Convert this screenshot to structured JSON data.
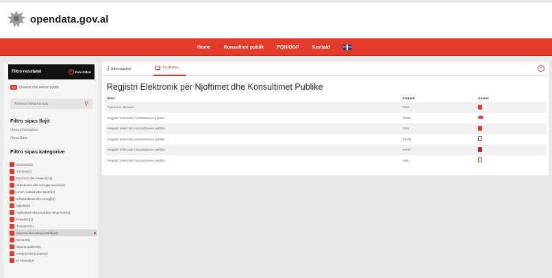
{
  "site": {
    "logo_bold": "open",
    "logo_rest": "data.gov.al"
  },
  "nav": {
    "items": [
      "Home",
      "Konsultimi publik",
      "PQH/OGP",
      "Kontakt"
    ],
    "flag_icon": "uk-flag-icon"
  },
  "sidebar": {
    "filter_title": "Filtro rezultatet",
    "clear_label": "Fshi Filtrat",
    "active_tag_badge": "Kat",
    "active_tag_text": "Qeveria dhe sektori publik",
    "search_placeholder": "Plotëson kërkimin tuaj",
    "type_title": "Filtro sipas llojit",
    "types": [
      "OpenInformation",
      "OpenData"
    ],
    "category_title": "Filtro sipas kategorive",
    "categories": [
      "Diaspora(3)",
      "Turizëm(2)",
      "Ekonomi dhe Financa(11)",
      "Shëndetësi dhe mbrojtje sociale(3)",
      "Arsim, kulturë dhe sport(11)",
      "Infrastrukturë dhe energji(6)",
      "Mjedisi(5)",
      "Agrikulturë dhe produkte ushqimore(4)",
      "Popullsia(1)",
      "Transport(1)",
      "Qeveria dhe sektori publik(23)",
      "Biznes(9)",
      "Siguria publike(6)",
      "Integrimi në Europë(1)",
      "In Albania(4)"
    ],
    "selected_category_index": 10
  },
  "main": {
    "tabs": [
      {
        "label": "Informacion",
        "icon": "info-icon"
      },
      {
        "label": "Të dhëna",
        "icon": "table-icon"
      }
    ],
    "active_tab": 1,
    "title": "Regjistri Elektronik për Njoftimet dhe Konsultimet Publike",
    "table": {
      "headers": [
        "Emri",
        "Formati",
        "Aksesi"
      ],
      "rows": [
        {
          "name": "Fjalori i të dhënave",
          "format": "CSV",
          "icon": "csv-file-icon"
        },
        {
          "name": "Regjistri elektronik i konsultimeve publike",
          "format": "HTML",
          "icon": "eye-icon"
        },
        {
          "name": "Regjistri elektronik i konsultimeve publike",
          "format": "CSV",
          "icon": "csv-file-icon"
        },
        {
          "name": "Regjistri elektronik i konsultimeve publike",
          "format": "JSON",
          "icon": "json-file-icon"
        },
        {
          "name": "Regjistri elektronik i konsultimeve publike",
          "format": "Excel",
          "icon": "excel-file-icon"
        },
        {
          "name": "Regjistri elektronik i konsultimeve publike",
          "format": "XML",
          "icon": "xml-file-icon"
        }
      ]
    }
  },
  "colors": {
    "accent": "#e1392a",
    "background": "#e9e9e9"
  }
}
